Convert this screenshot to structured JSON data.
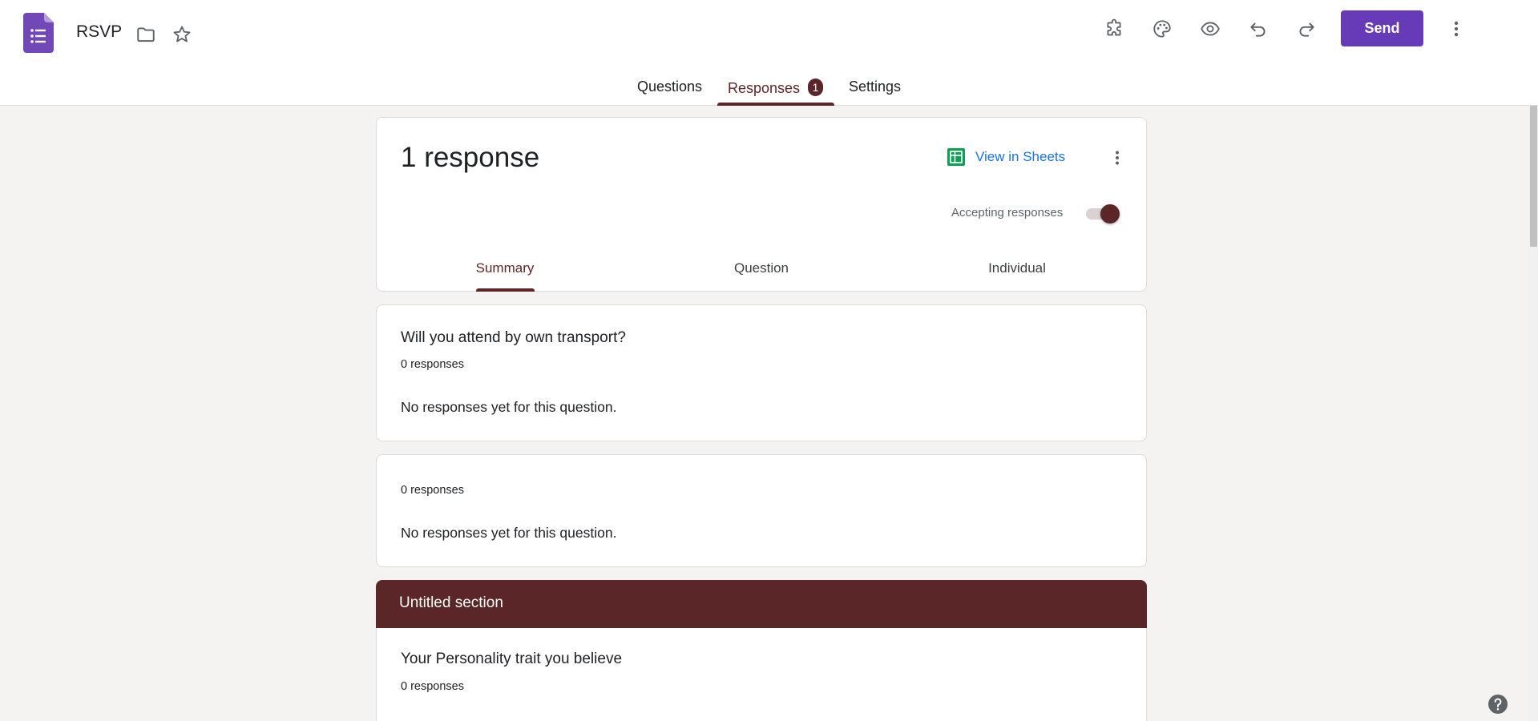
{
  "header": {
    "title": "RSVP",
    "send_label": "Send",
    "brand_color": "#673ab7"
  },
  "main_tabs": [
    {
      "label": "Questions"
    },
    {
      "label": "Responses",
      "badge": "1"
    },
    {
      "label": "Settings"
    }
  ],
  "summary": {
    "count_label": "1 response",
    "sheets_label": "View in Sheets",
    "accepting_label": "Accepting responses",
    "accepting": true,
    "tabs": [
      "Summary",
      "Question",
      "Individual"
    ]
  },
  "questions": [
    {
      "title": "Will you attend by own transport?",
      "count": "0 responses",
      "empty": "No responses yet for this question."
    },
    {
      "title": "",
      "count": "0 responses",
      "empty": "No responses yet for this question."
    }
  ],
  "section": {
    "title": "Untitled section",
    "question": {
      "title": "Your Personality trait you believe",
      "count": "0 responses"
    }
  },
  "theme": {
    "accent": "#5b2628",
    "link": "#1a73e8",
    "sheets_green": "#0f9d58"
  },
  "icons": [
    "forms-logo-icon",
    "folder-icon",
    "star-icon",
    "addon-puzzle-icon",
    "palette-icon",
    "preview-eye-icon",
    "undo-icon",
    "redo-icon",
    "more-vert-icon",
    "sheets-icon",
    "help-icon"
  ]
}
